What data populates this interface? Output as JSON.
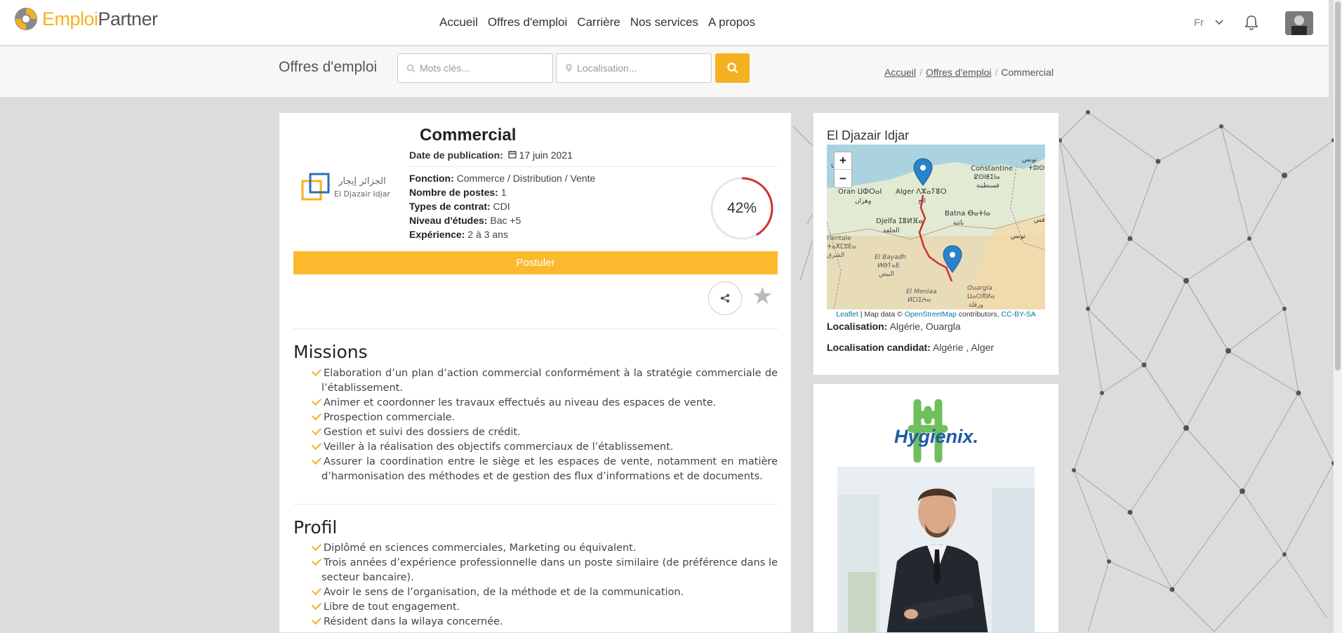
{
  "brand": {
    "part1": "Emploi",
    "part2": "Partner"
  },
  "menu": [
    "Accueil",
    "Offres d'emploi",
    "Carrière",
    "Nos services",
    "A propos"
  ],
  "lang": "Fr",
  "search": {
    "title": "Offres d'emploi",
    "keywords_placeholder": "Mots clés...",
    "location_placeholder": "Localisation..."
  },
  "breadcrumb": {
    "home": "Accueil",
    "jobs": "Offres d'emploi",
    "current": "Commercial"
  },
  "job": {
    "title": "Commercial",
    "pub_label": "Date de publication:",
    "pub_date": "17 juin 2021",
    "company_logo_ar": "الجزائر إيجار",
    "company_logo_fr": "El Djazair Idjar",
    "fonction_label": "Fonction:",
    "fonction": "Commerce / Distribution / Vente",
    "postes_label": "Nombre de postes:",
    "postes": "1",
    "contrat_label": "Types de contrat:",
    "contrat": "CDI",
    "etudes_label": "Niveau d'études:",
    "etudes": "Bac +5",
    "experience_label": "Expérience:",
    "experience": "2 à 3 ans",
    "match": "42%",
    "match_value": 0.42,
    "apply_label": "Postuler"
  },
  "missions": {
    "heading": "Missions",
    "items": [
      "Elaboration d’un plan d’action commercial conformément à la stratégie commerciale de l’établissement.",
      "Animer et coordonner les travaux effectués au niveau des espaces de vente.",
      "Prospection commerciale.",
      "Gestion et suivi des dossiers de crédit.",
      "Veiller à la réalisation des objectifs commerciaux de l’établissement.",
      "Assurer la coordination entre le siège et les espaces de vente, notamment en matière d’harmonisation des méthodes et de gestion des flux d’informations et de documents."
    ]
  },
  "profil": {
    "heading": "Profil",
    "items": [
      "Diplômé en sciences commerciales, Marketing ou équivalent.",
      "Trois années d’expérience professionnelle dans un poste similaire (de préférence dans le secteur bancaire).",
      "Avoir le sens de l’organisation, de la méthode et de la communication.",
      "Libre de tout engagement.",
      "Résident dans la wilaya concernée."
    ]
  },
  "sidebar": {
    "company": "El Djazair Idjar",
    "map": {
      "zoom_in": "+",
      "zoom_out": "−",
      "attrib_leaflet": "Leaflet",
      "attrib_mid": " | Map data © ",
      "attrib_osm": "OpenStreetMap",
      "attrib_contrib": " contributors, ",
      "attrib_license": "CC-BY-SA",
      "labels": {
        "murcia": "urcia",
        "oran": "Oran ⵡⵀⵔⴰⵏ",
        "oran_ar": "وهران",
        "alger": "Alger ⴷⵣⴰⵢⴻⵔ",
        "alger_ar": "الج",
        "constantine": "Constantine",
        "constantine_tz": "ⵇⵙⵏⵟⵉⵏⴰ",
        "constantine_ar": "قسنطينة",
        "tunis_ar": "تونس",
        "tunis_tz": "ⵜⵓⵏⵙ",
        "sfax_ar": "صفاقس",
        "batna": "Batna ⴱⴰⵜⵏⴰ",
        "batna_ar": "باتنة",
        "djelfa": "Djelfa ⵊⴻⵍⴼⴰ",
        "djelfa_ar": "الجلفة",
        "tunisie": "تونس",
        "oriental": "rientale",
        "oriental_tz": "ⵜⴰⴳⵎⵓⴹⴰ",
        "oriental_ar": "الشرق",
        "bayadh": "El Bayadh",
        "bayadh_tz": "ⵍⴱⵢⴰⴹ",
        "bayadh_ar": "البيض",
        "ouargla": "Ouargla",
        "ouargla_tz": "ⵡⴰⵔⴳⵍⴰ",
        "ouargla_ar": "ورقلة",
        "meniaa": "El Meniaa",
        "meniaa_tz": "ⵍⵎⵏⵉⵄⴰ"
      }
    },
    "loc_label": "Localisation:",
    "loc": "Algérie, Ouargla",
    "loc_cand_label": "Localisation candidat:",
    "loc_cand": "Algérie , Alger",
    "ad_brand": "Hygienix."
  },
  "colors": {
    "accent": "#f5b120",
    "apply": "#fbba2d",
    "gauge": "#d32f2f"
  },
  "icons": [
    "search-icon",
    "location-pin-icon",
    "bell-icon",
    "chevron-down-icon",
    "calendar-icon",
    "share-icon",
    "star-icon",
    "check-icon",
    "map-marker-icon"
  ]
}
